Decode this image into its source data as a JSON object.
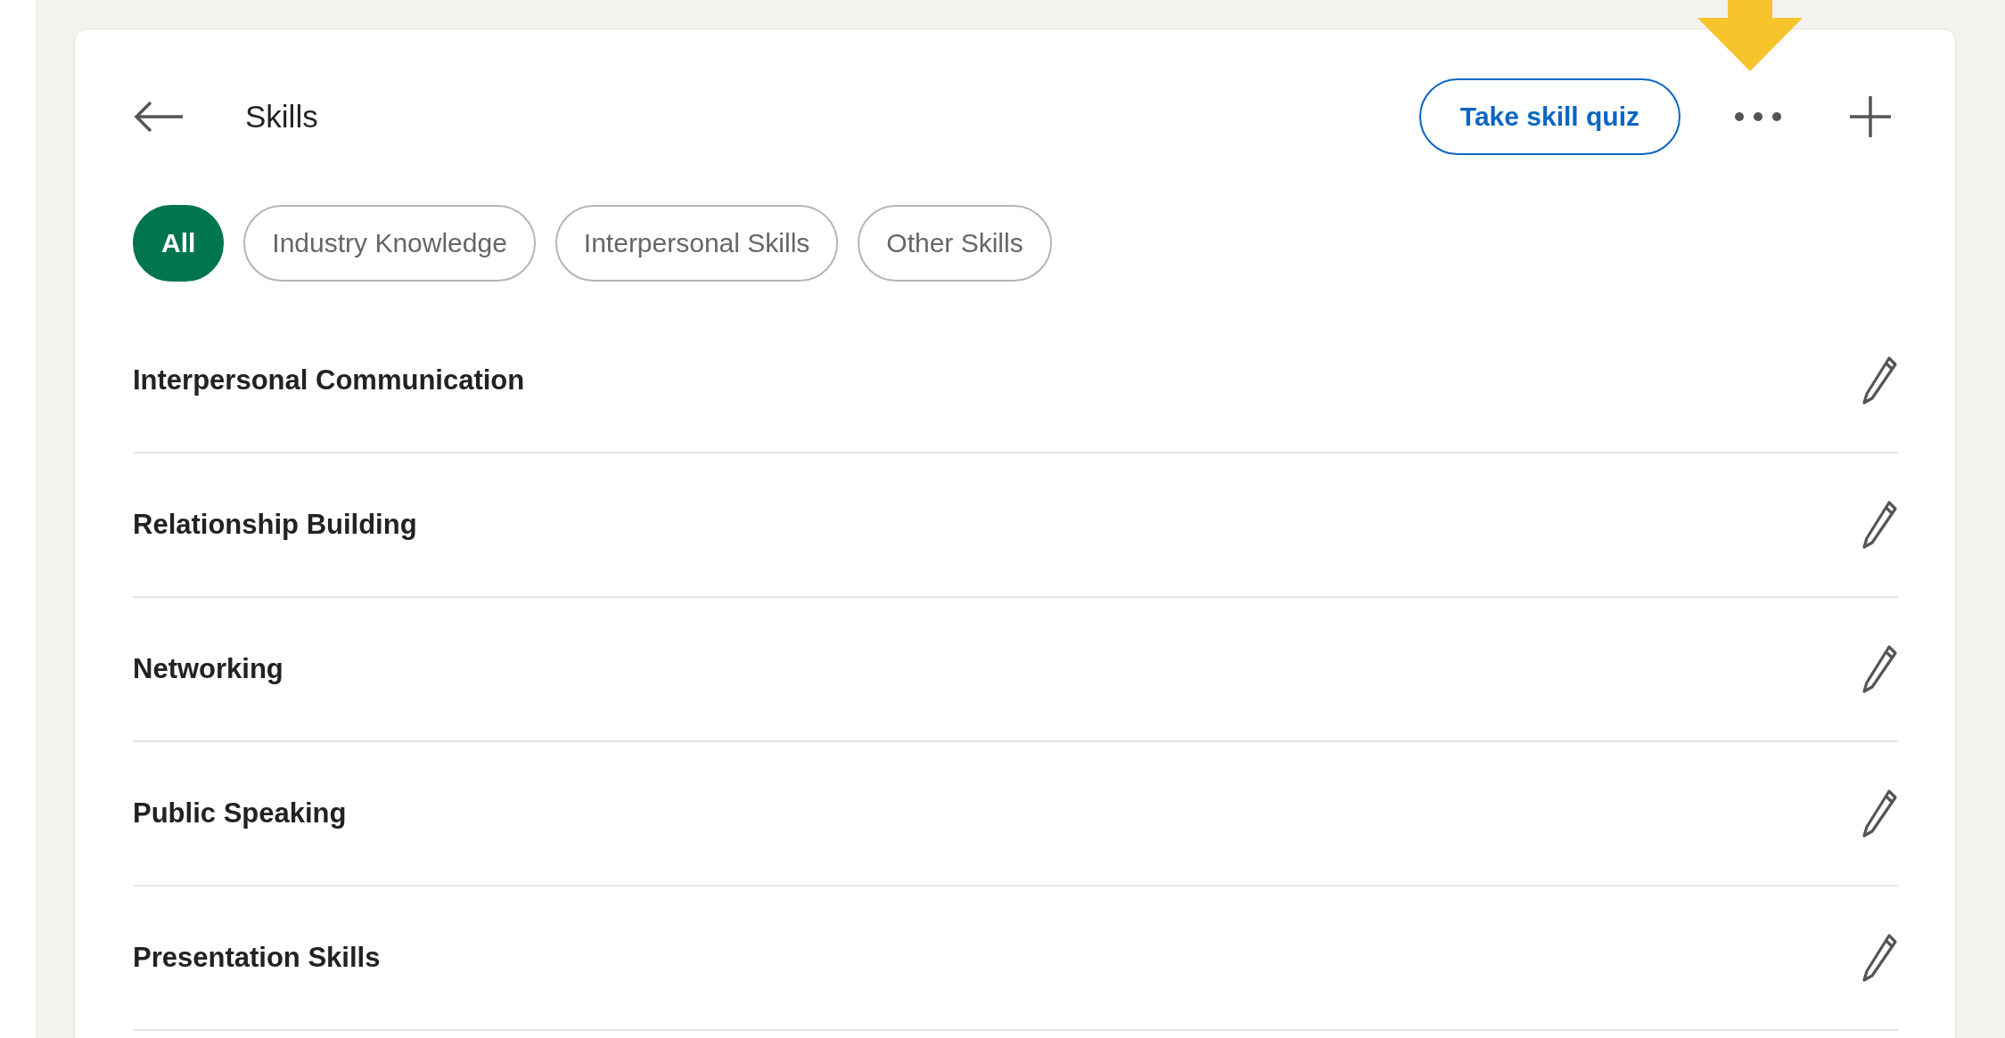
{
  "header": {
    "title": "Skills",
    "quiz_button": "Take skill quiz"
  },
  "filters": [
    {
      "label": "All",
      "selected": true
    },
    {
      "label": "Industry Knowledge",
      "selected": false
    },
    {
      "label": "Interpersonal Skills",
      "selected": false
    },
    {
      "label": "Other Skills",
      "selected": false
    }
  ],
  "skills": [
    {
      "name": "Interpersonal Communication"
    },
    {
      "name": "Relationship Building"
    },
    {
      "name": "Networking"
    },
    {
      "name": "Public Speaking"
    },
    {
      "name": "Presentation Skills"
    }
  ]
}
